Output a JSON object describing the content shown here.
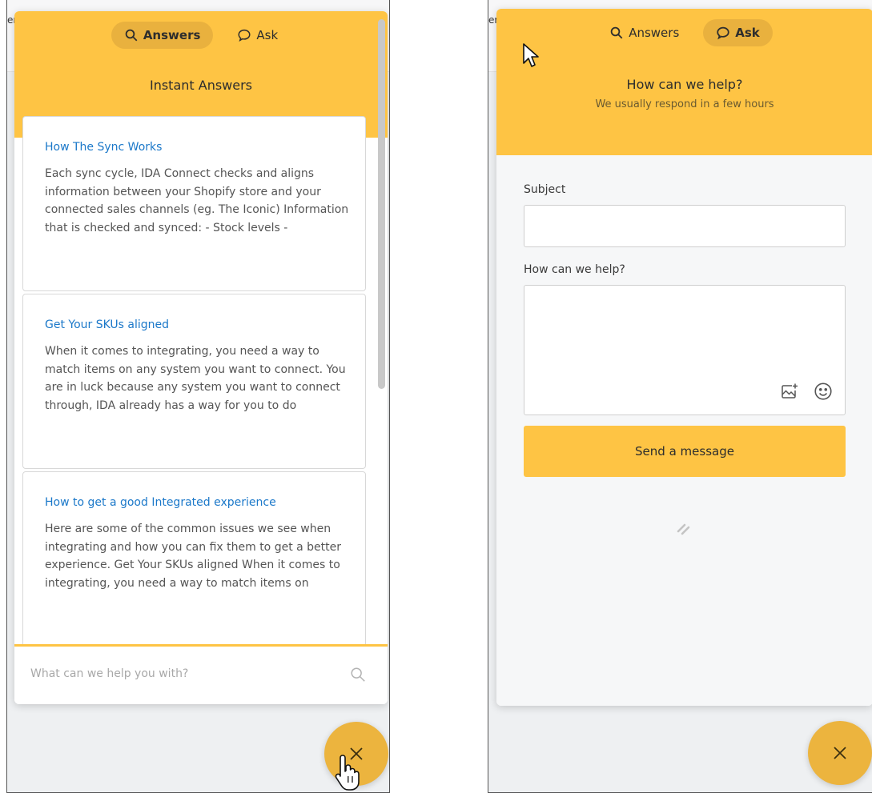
{
  "left_panel": {
    "edge_text": "er",
    "tabs": [
      {
        "label": "Answers",
        "icon": "search-icon",
        "active": true
      },
      {
        "label": "Ask",
        "icon": "chat-bubble-icon",
        "active": false
      }
    ],
    "title": "Instant Answers",
    "articles": [
      {
        "title": "How The Sync Works",
        "body": "Each sync cycle, IDA Connect checks and aligns information between your Shopify store and your connected sales channels (eg. The Iconic) Information that is checked and synced: - Stock levels -"
      },
      {
        "title": "Get Your SKUs aligned",
        "body": "When it comes to integrating, you need a way to match items on any system you want to connect. You are in luck because any system you want to connect through, IDA already has a way for you to do"
      },
      {
        "title": "How to get a good Integrated experience",
        "body": "Here are some of the common issues we see when integrating and how you can fix them to get a better experience. Get Your SKUs aligned When it comes to integrating, you need a way to match items on"
      }
    ],
    "search": {
      "placeholder": "What can we help you with?"
    }
  },
  "right_panel": {
    "edge_text": "er",
    "tabs": [
      {
        "label": "Answers",
        "icon": "search-icon",
        "active": false
      },
      {
        "label": "Ask",
        "icon": "chat-bubble-icon",
        "active": true
      }
    ],
    "title": "How can we help?",
    "subtitle": "We usually respond in a few hours",
    "form": {
      "subject_label": "Subject",
      "subject_value": "",
      "message_label": "How can we help?",
      "message_value": "",
      "send_label": "Send a message"
    }
  },
  "colors": {
    "brand_yellow": "#fec444",
    "tab_active": "#e9b13e",
    "fab": "#ecb43e",
    "link_blue": "#1b78c9"
  }
}
